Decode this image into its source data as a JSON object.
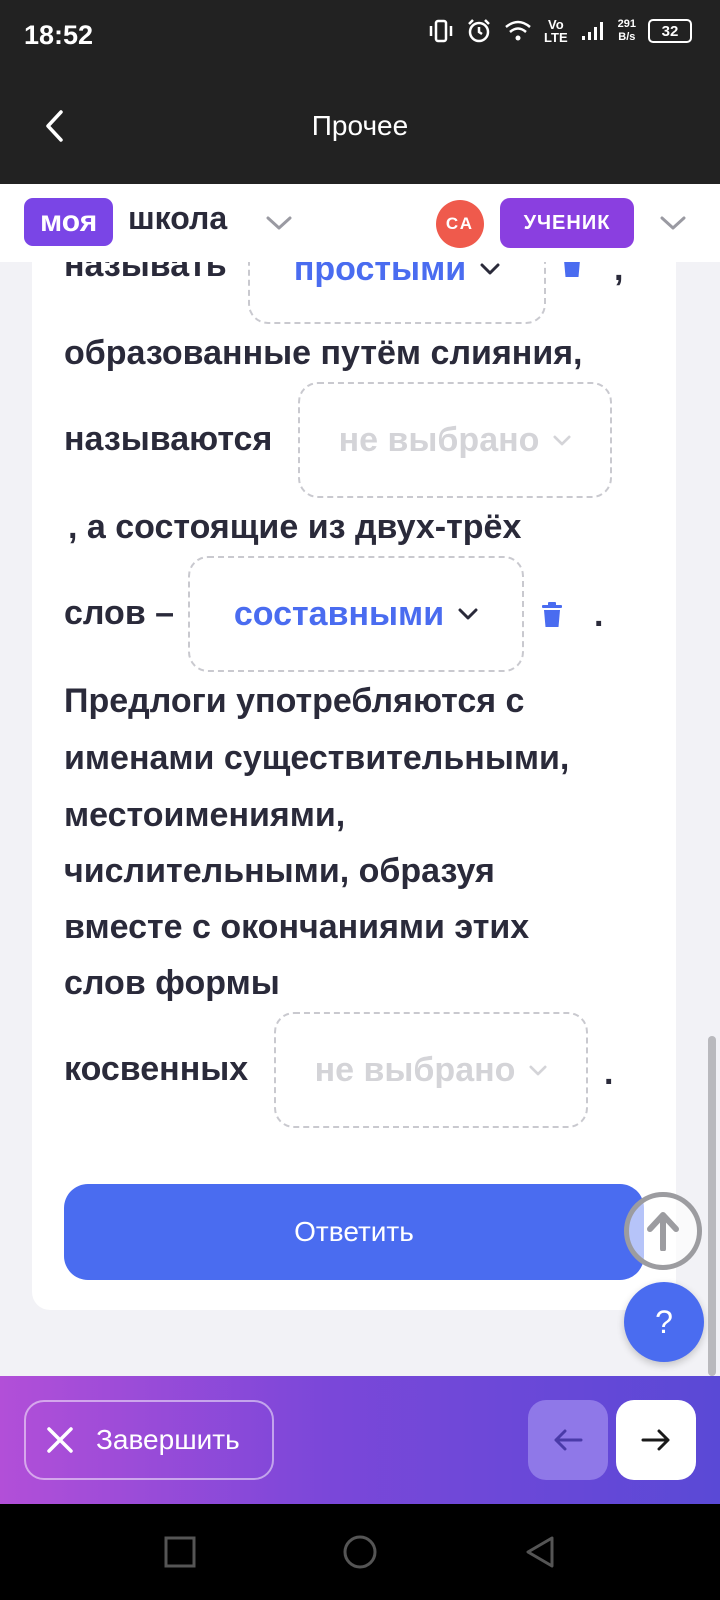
{
  "status_bar": {
    "time": "18:52",
    "network_label": "Vo\nLTE",
    "speed_value": "291",
    "speed_unit": "B/s",
    "battery": "32"
  },
  "header": {
    "title": "Прочее"
  },
  "school_bar": {
    "logo_part1": "моя",
    "logo_part2": "школа",
    "avatar_initials": "СА",
    "role": "УЧЕНИК"
  },
  "exercise": {
    "line1_text": "называть",
    "dropdown1_value": "простыми",
    "line1_comma": ",",
    "line2_text": "образованные путём слияния,",
    "line3_text": "называются",
    "dropdown2_placeholder": "не выбрано",
    "line4_text": ", а состоящие из двух-трёх",
    "line5_text": "слов –",
    "dropdown3_value": "составными",
    "line5_period": ".",
    "paragraph_lines": [
      "Предлоги употребляются с",
      "именами существительными,",
      "местоимениями,",
      "числительными, образуя",
      "вместе с окончаниями этих",
      "слов формы"
    ],
    "last_line_text": "косвенных",
    "dropdown4_placeholder": "не выбрано",
    "last_line_period": "."
  },
  "actions": {
    "submit_label": "Ответить",
    "help_label": "?",
    "finish_label": "Завершить"
  },
  "colors": {
    "accent": "#4a6cf0",
    "brand_purple": "#7a45e6",
    "dark_header": "#222222"
  }
}
